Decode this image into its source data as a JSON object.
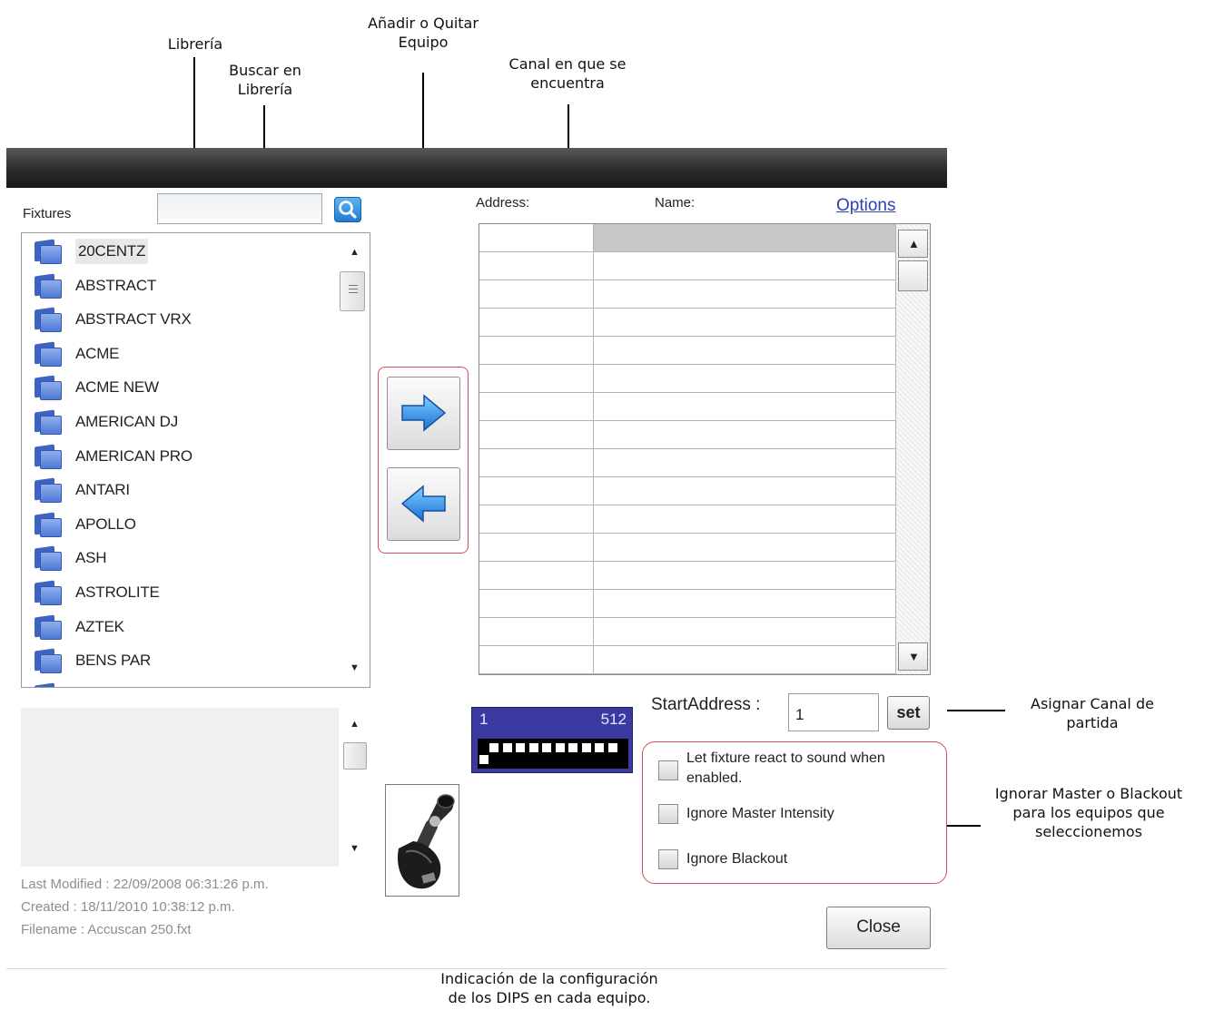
{
  "annotations": {
    "library": "Librería",
    "search_line1": "Buscar en",
    "search_line2": "Librería",
    "add_remove_line1": "Añadir o Quitar",
    "add_remove_line2": "Equipo",
    "channel_line1": "Canal en que se",
    "channel_line2": "encuentra",
    "assign_line1": "Asignar Canal de",
    "assign_line2": "partida",
    "ignore_line1": "Ignorar Master o Blackout",
    "ignore_line2": "para los equipos que",
    "ignore_line3": "seleccionemos",
    "dips_line1": "Indicación de la configuración",
    "dips_line2": "de los DIPS en cada equipo."
  },
  "left_panel": {
    "fixtures_label": "Fixtures",
    "search_value": "",
    "items": [
      "20CENTZ",
      "ABSTRACT",
      "ABSTRACT VRX",
      "ACME",
      "ACME NEW",
      "AMERICAN DJ",
      "AMERICAN PRO",
      "ANTARI",
      "APOLLO",
      "ASH",
      "ASTROLITE",
      "AZTEK",
      "BENS PAR"
    ],
    "selected_index": 0,
    "last_modified": "Last Modified : 22/09/2008 06:31:26 p.m.",
    "created": "Created : 18/11/2010 10:38:12 p.m.",
    "filename": "Filename : Accuscan 250.fxt"
  },
  "right_panel": {
    "address_header": "Address:",
    "name_header": "Name:",
    "options_link": "Options",
    "row_count": 16,
    "dip_start": "1",
    "dip_end": "512",
    "start_address_label": "StartAddress :",
    "start_address_value": "1",
    "set_label": "set",
    "options": [
      {
        "line1": "Let fixture react to sound when",
        "line2": "enabled.",
        "checked": false
      },
      {
        "label": "Ignore Master Intensity",
        "checked": false
      },
      {
        "label": "Ignore Blackout",
        "checked": false
      }
    ],
    "close_label": "Close"
  },
  "colors": {
    "accent_blue": "#1d7bd1",
    "dip_blue": "#3a3aa0",
    "highlight_red": "#d94b5b",
    "link_blue": "#2b3fb8"
  }
}
